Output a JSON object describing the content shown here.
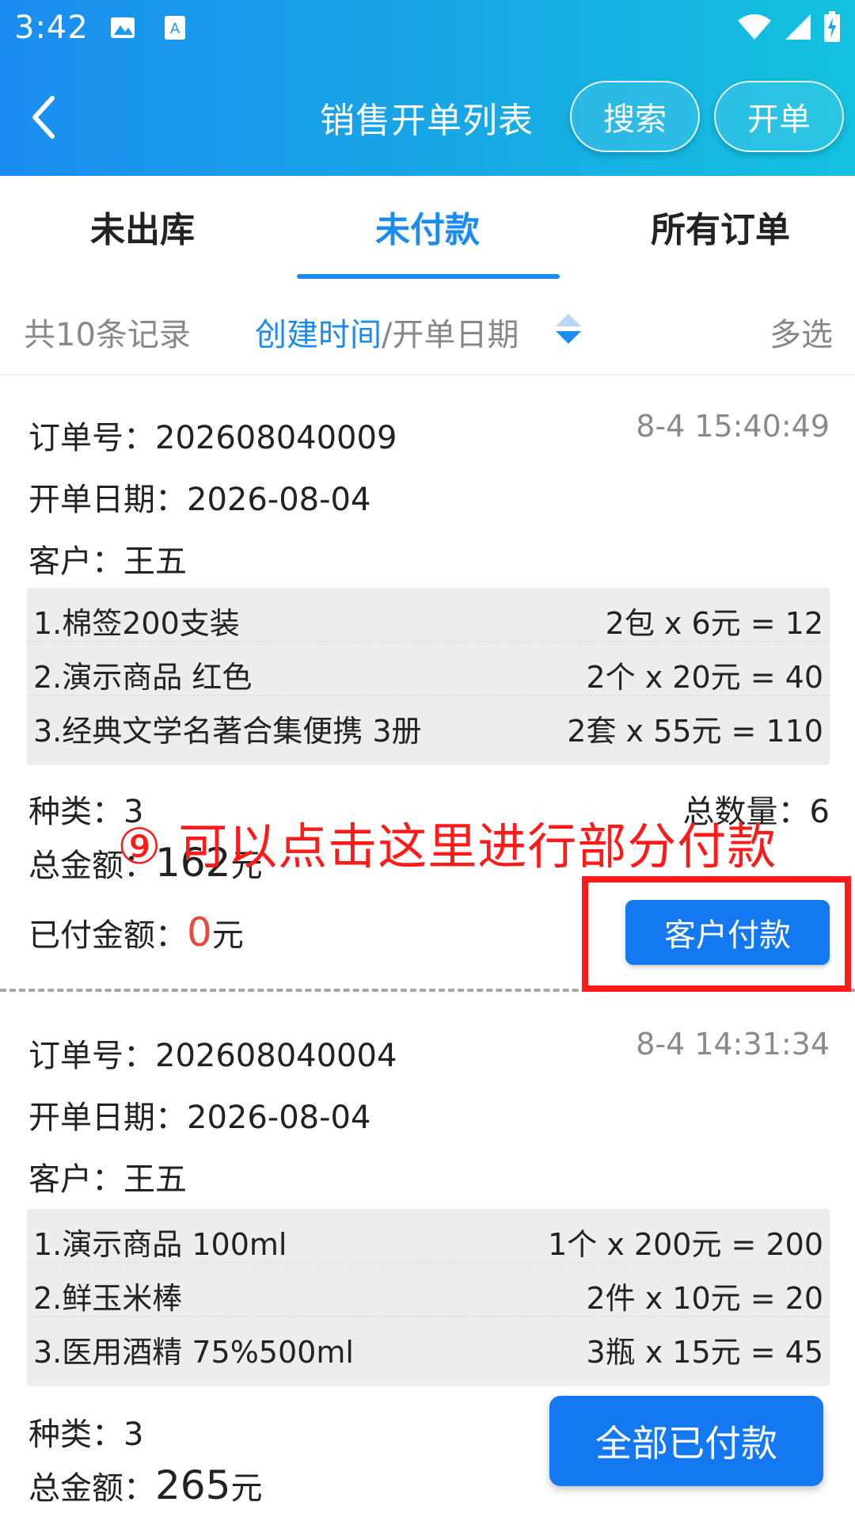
{
  "status_bar": {
    "time": "3:42"
  },
  "header": {
    "title": "销售开单列表",
    "search_label": "搜索",
    "open_label": "开单"
  },
  "tabs": [
    {
      "label": "未出库"
    },
    {
      "label": "未付款"
    },
    {
      "label": "所有订单"
    }
  ],
  "filter": {
    "record_count": "共10条记录",
    "sort_primary": "创建时间",
    "sort_secondary": "/开单日期",
    "multi_select": "多选"
  },
  "orders": [
    {
      "order_no": "订单号：202608040009",
      "time": "8-4 15:40:49",
      "date": "开单日期：2026-08-04",
      "customer": "客户：王五",
      "items": [
        {
          "name": "1.棉签200支装",
          "calc": "2包 x 6元 = 12"
        },
        {
          "name": "2.演示商品 红色",
          "calc": "2个 x 20元 = 40"
        },
        {
          "name": "3.经典文学名著合集便携 3册",
          "calc": "2套 x 55元 = 110"
        }
      ],
      "kind": "种类：3",
      "qty": "总数量：6",
      "amount_label": "总金额：",
      "amount_value": "162",
      "amount_unit": "元",
      "paid_label": "已付金额：",
      "paid_value": "0",
      "paid_unit": "元",
      "pay_button": "客户付款"
    },
    {
      "order_no": "订单号：202608040004",
      "time": "8-4 14:31:34",
      "date": "开单日期：2026-08-04",
      "customer": "客户：王五",
      "items": [
        {
          "name": "1.演示商品 100ml",
          "calc": "1个 x 200元 = 200"
        },
        {
          "name": "2.鲜玉米棒",
          "calc": "2件 x 10元 = 20"
        },
        {
          "name": "3.医用酒精 75%500ml",
          "calc": "3瓶 x 15元 = 45"
        }
      ],
      "kind": "种类：3",
      "amount_label": "总金额：",
      "amount_value": "265",
      "amount_unit": "元"
    }
  ],
  "annotation": "⑨ 可以点击这里进行部分付款",
  "all_paid_button": "全部已付款",
  "colors": {
    "accent": "#1a8cf0",
    "button": "#1478f0",
    "annotation_red": "#ff1a1a",
    "paid_red": "#e84a3a"
  }
}
